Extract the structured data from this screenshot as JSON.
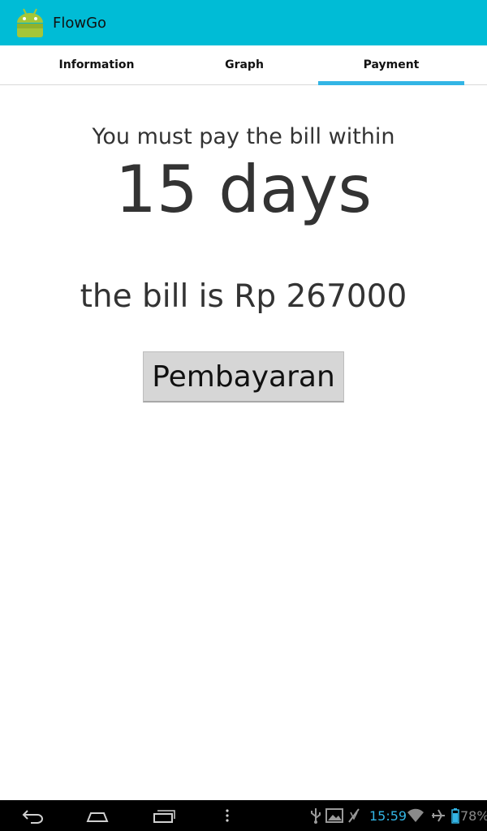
{
  "app": {
    "title": "FlowGo",
    "bar_color": "#00bcd6",
    "icon": "android-robot-icon"
  },
  "tabs": [
    {
      "label": "Information",
      "active": false
    },
    {
      "label": "Graph",
      "active": false
    },
    {
      "label": "Payment",
      "active": true
    }
  ],
  "tab_indicator_color": "#33b5e5",
  "payment": {
    "notice": "You must pay the bill within",
    "days": "15 days",
    "bill": "the bill is Rp 267000",
    "button_label": "Pembayaran"
  },
  "system_bar": {
    "nav_icons": [
      "back-icon",
      "home-icon",
      "recent-apps-icon",
      "menu-icon"
    ],
    "status_icons": [
      "usb-icon",
      "gallery-icon",
      "no-sync-icon",
      "wifi-icon",
      "airplane-icon",
      "battery-icon"
    ],
    "time": "15:59",
    "battery": "78%"
  }
}
